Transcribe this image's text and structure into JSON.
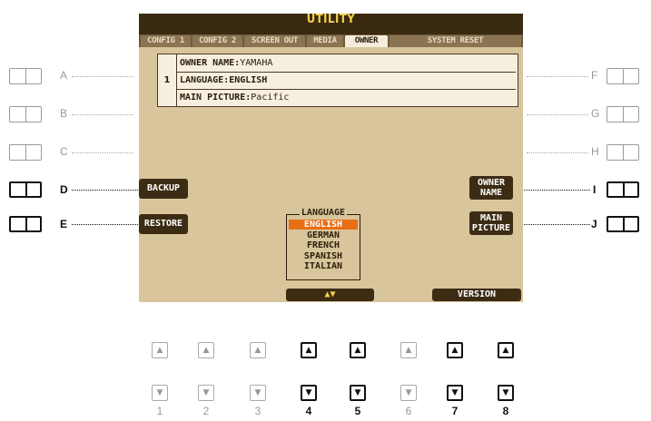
{
  "screen": {
    "title": "UTILITY",
    "tabs": [
      {
        "label": "CONFIG 1",
        "active": false
      },
      {
        "label": "CONFIG 2",
        "active": false
      },
      {
        "label": "SCREEN OUT",
        "active": false
      },
      {
        "label": "MEDIA",
        "active": false
      },
      {
        "label": "OWNER",
        "active": true
      },
      {
        "label": "SYSTEM RESET",
        "active": false
      }
    ],
    "info": {
      "number": "1",
      "owner_name_key": "OWNER NAME:",
      "owner_name_value": "YAMAHA",
      "language_key": "LANGUAGE:",
      "language_value": "ENGLISH",
      "main_picture_key": "MAIN PICTURE:",
      "main_picture_value": "Pacific"
    },
    "buttons": {
      "backup": "BACKUP",
      "restore": "RESTORE",
      "owner_name_line1": "OWNER",
      "owner_name_line2": "NAME",
      "main_picture_line1": "MAIN",
      "main_picture_line2": "PICTURE",
      "version": "VERSION",
      "updown": "▲▼"
    },
    "language_list": {
      "title": "LANGUAGE",
      "items": [
        "ENGLISH",
        "GERMAN",
        "FRENCH",
        "SPANISH",
        "ITALIAN"
      ],
      "selected": "ENGLISH"
    }
  },
  "side_buttons": {
    "left": [
      {
        "label": "A",
        "active": false
      },
      {
        "label": "B",
        "active": false
      },
      {
        "label": "C",
        "active": false
      },
      {
        "label": "D",
        "active": true
      },
      {
        "label": "E",
        "active": true
      }
    ],
    "right": [
      {
        "label": "F",
        "active": false
      },
      {
        "label": "G",
        "active": false
      },
      {
        "label": "H",
        "active": false
      },
      {
        "label": "I",
        "active": true
      },
      {
        "label": "J",
        "active": true
      }
    ]
  },
  "number_buttons": [
    {
      "label": "1",
      "active": false
    },
    {
      "label": "2",
      "active": false
    },
    {
      "label": "3",
      "active": false
    },
    {
      "label": "4",
      "active": true
    },
    {
      "label": "5",
      "active": true
    },
    {
      "label": "6",
      "active": false
    },
    {
      "label": "7",
      "active": true
    },
    {
      "label": "8",
      "active": true
    }
  ],
  "colors": {
    "lcd_background": "#d9c59b",
    "title_bar": "#3a2a12",
    "title_text": "#f6d24a",
    "selection_highlight": "#e86f14"
  }
}
